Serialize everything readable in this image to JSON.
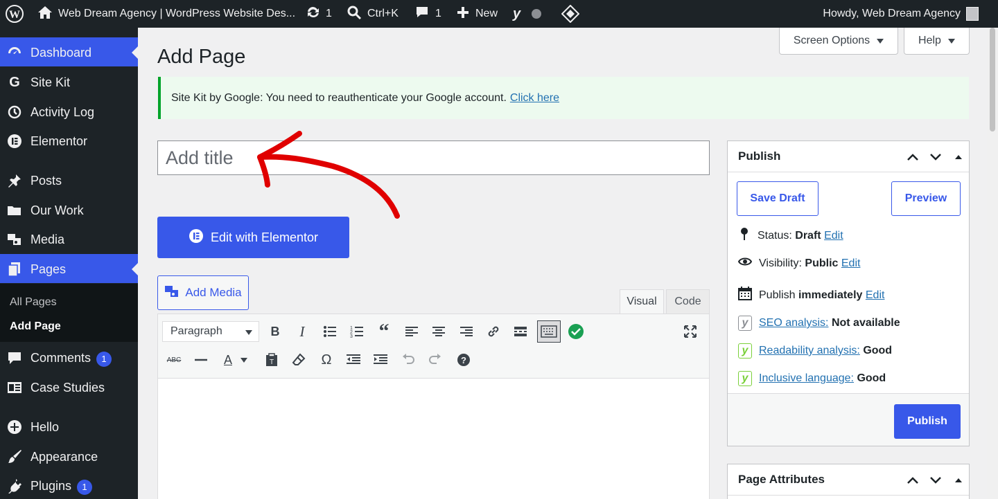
{
  "admin_bar": {
    "site_name": "Web Dream Agency | WordPress Website Des...",
    "updates_count": "1",
    "search_shortcut": "Ctrl+K",
    "comments_count": "1",
    "new_label": "New",
    "greeting": "Howdy, Web Dream Agency"
  },
  "sidebar": {
    "items": [
      {
        "label": "Dashboard",
        "icon": "dashboard-icon"
      },
      {
        "label": "Site Kit",
        "icon": "google-icon"
      },
      {
        "label": "Activity Log",
        "icon": "history-icon"
      },
      {
        "label": "Elementor",
        "icon": "elementor-icon"
      },
      {
        "label": "Posts",
        "icon": "pin-icon"
      },
      {
        "label": "Our Work",
        "icon": "folder-icon"
      },
      {
        "label": "Media",
        "icon": "media-icon"
      },
      {
        "label": "Pages",
        "icon": "pages-icon"
      },
      {
        "label": "Comments",
        "icon": "comment-icon",
        "badge": "1"
      },
      {
        "label": "Case Studies",
        "icon": "case-studies-icon"
      },
      {
        "label": "Hello",
        "icon": "plus-circle-icon"
      },
      {
        "label": "Appearance",
        "icon": "brush-icon"
      },
      {
        "label": "Plugins",
        "icon": "plugin-icon",
        "badge": "1"
      }
    ],
    "submenu": {
      "all_pages": "All Pages",
      "add_page": "Add Page"
    }
  },
  "header": {
    "screen_options": "Screen Options",
    "help": "Help",
    "page_title": "Add Page"
  },
  "notice": {
    "text": "Site Kit by Google: You need to reauthenticate your Google account.",
    "link": "Click here"
  },
  "editor": {
    "title_placeholder": "Add title",
    "elementor_button": "Edit with Elementor",
    "add_media": "Add Media",
    "tab_visual": "Visual",
    "tab_code": "Code",
    "format_value": "Paragraph"
  },
  "publish": {
    "heading": "Publish",
    "save_draft": "Save Draft",
    "preview": "Preview",
    "status_label": "Status:",
    "status_value": "Draft",
    "visibility_label": "Visibility:",
    "visibility_value": "Public",
    "publish_label": "Publish",
    "publish_value": "immediately",
    "edit": "Edit",
    "seo_label": "SEO analysis:",
    "seo_value": "Not available",
    "readability_label": "Readability analysis:",
    "readability_value": "Good",
    "inclusive_label": "Inclusive language:",
    "inclusive_value": "Good",
    "publish_button": "Publish"
  },
  "page_attributes": {
    "heading": "Page Attributes"
  },
  "colors": {
    "accent": "#3858e9",
    "admin_bar": "#1d2327",
    "notice_border": "#00a32a",
    "annotation": "#e00000",
    "yoast_good": "#7ad03a"
  }
}
